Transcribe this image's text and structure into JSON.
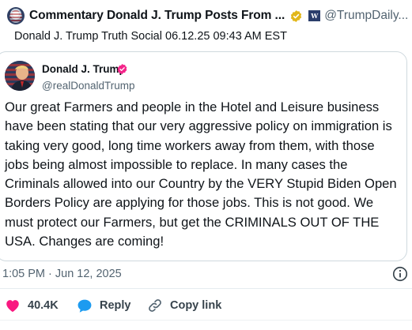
{
  "header": {
    "name": "Commentary Donald J. Trump Posts From ...",
    "badge_text": "W",
    "handle": "@TrumpDaily..."
  },
  "subtitle": "Donald J. Trump Truth Social 06.12.25 09:43 AM EST",
  "post": {
    "author_name": "Donald J. Trump",
    "author_handle": "@realDonaldTrump",
    "lines": [
      "Our great Farmers and people in the Hotel and Leisure business",
      "have been stating that our very aggressive policy on immigration is",
      "taking very good, long time workers away from them, with those",
      "jobs being almost impossible to replace. In many cases the",
      "Criminals allowed into our Country by the VERY Stupid Biden Open",
      "Borders Policy are applying for those jobs. This is not good. We",
      "must protect our Farmers, but get the CRIMINALS OUT OF THE",
      "USA. Changes are coming!"
    ]
  },
  "meta": {
    "timestamp": "1:05 PM · Jun 12, 2025"
  },
  "actions": {
    "like_count": "40.4K",
    "reply_label": "Reply",
    "copy_label": "Copy link"
  },
  "colors": {
    "like_heart": "#f91880",
    "reply_bubble": "#1d9bf0",
    "verified_gold": "#e2b719",
    "verified_pink": "#f4258a",
    "muted_text": "#536471"
  },
  "icons": {
    "header_avatar": "avatar",
    "gold_badge": "verified-gold-icon",
    "pink_badge": "verified-pink-icon",
    "info": "info-icon",
    "like": "heart-icon",
    "reply": "reply-bubble-icon",
    "copy": "link-icon"
  }
}
